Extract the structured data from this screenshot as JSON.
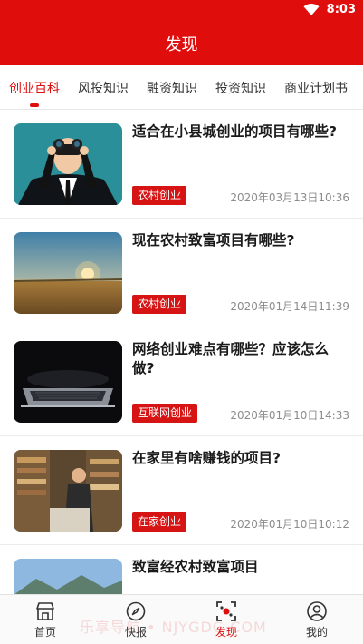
{
  "status": {
    "time": "8:03"
  },
  "header": {
    "title": "发现"
  },
  "tabs": [
    {
      "label": "创业百科",
      "active": true
    },
    {
      "label": "风投知识",
      "active": false
    },
    {
      "label": "融资知识",
      "active": false
    },
    {
      "label": "投资知识",
      "active": false
    },
    {
      "label": "商业计划书",
      "active": false
    }
  ],
  "articles": [
    {
      "title": "适合在小县城创业的项目有哪些?",
      "tag": "农村创业",
      "date": "2020年03月13日10:36",
      "image": "businessman-binoculars"
    },
    {
      "title": "现在农村致富项目有哪些?",
      "tag": "农村创业",
      "date": "2020年01月14日11:39",
      "image": "field-sunset"
    },
    {
      "title": "网络创业难点有哪些？应该怎么做?",
      "tag": "互联网创业",
      "date": "2020年01月10日14:33",
      "image": "laptop-dark"
    },
    {
      "title": "在家里有啥赚钱的项目?",
      "tag": "在家创业",
      "date": "2020年01月10日10:12",
      "image": "bookstore"
    },
    {
      "title": "致富经农村致富项目",
      "tag": "",
      "date": "",
      "image": "mountain-village"
    }
  ],
  "bottom_nav": [
    {
      "label": "首页",
      "icon": "shop-icon",
      "active": false
    },
    {
      "label": "快报",
      "icon": "compass-icon",
      "active": false
    },
    {
      "label": "发现",
      "icon": "discover-icon",
      "active": true
    },
    {
      "label": "我的",
      "icon": "user-icon",
      "active": false
    }
  ],
  "watermark": "乐享导航 • NJYGDG.COM",
  "colors": {
    "brand": "#e00d0d",
    "tag": "#d71414",
    "muted": "#8c8c8c"
  }
}
